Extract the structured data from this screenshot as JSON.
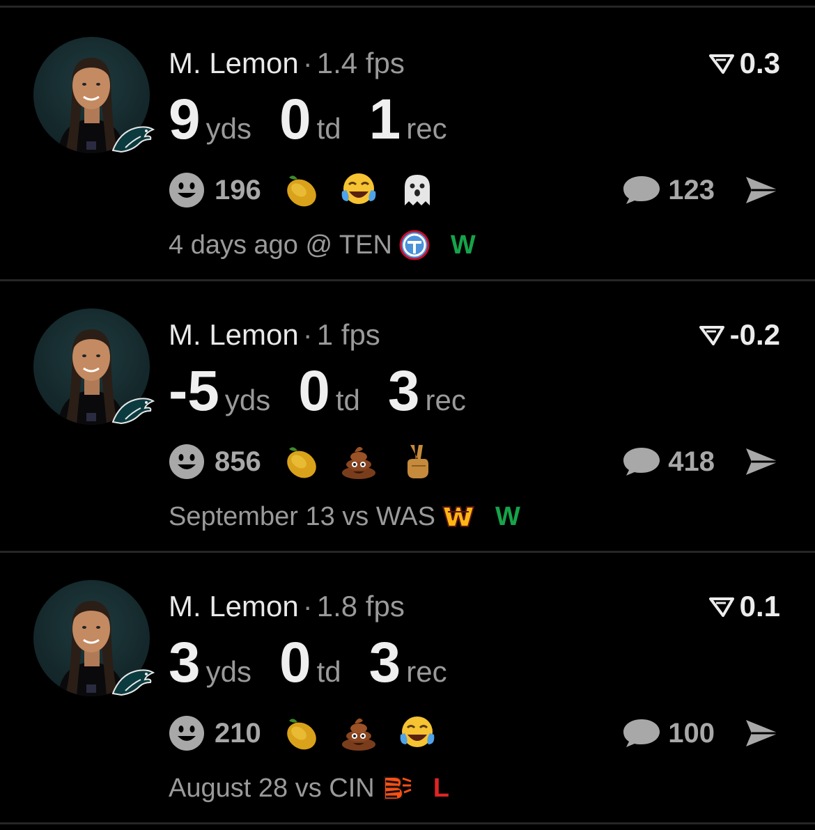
{
  "colors": {
    "win": "#16a34a",
    "loss": "#e02424",
    "background": "#000000"
  },
  "feed": [
    {
      "player": "M. Lemon",
      "fps": "1.4 fps",
      "rating": "0.3",
      "stats": [
        {
          "value": "9",
          "unit": "yds"
        },
        {
          "value": "0",
          "unit": "td"
        },
        {
          "value": "1",
          "unit": "rec"
        }
      ],
      "reaction_count": "196",
      "emojis": [
        "lemon-emoji",
        "tears-of-joy-emoji",
        "ghost-emoji"
      ],
      "comment_count": "123",
      "meta": "4 days ago @ TEN",
      "opponent_logo": "titans-logo",
      "result": "W"
    },
    {
      "player": "M. Lemon",
      "fps": "1 fps",
      "rating": "-0.2",
      "stats": [
        {
          "value": "-5",
          "unit": "yds"
        },
        {
          "value": "0",
          "unit": "td"
        },
        {
          "value": "3",
          "unit": "rec"
        }
      ],
      "reaction_count": "856",
      "emojis": [
        "lemon-emoji",
        "poop-emoji",
        "victory-hand-emoji"
      ],
      "comment_count": "418",
      "meta": "September 13 vs WAS",
      "opponent_logo": "commanders-logo",
      "result": "W"
    },
    {
      "player": "M. Lemon",
      "fps": "1.8 fps",
      "rating": "0.1",
      "stats": [
        {
          "value": "3",
          "unit": "yds"
        },
        {
          "value": "0",
          "unit": "td"
        },
        {
          "value": "3",
          "unit": "rec"
        }
      ],
      "reaction_count": "210",
      "emojis": [
        "lemon-emoji",
        "poop-emoji",
        "tears-of-joy-emoji"
      ],
      "comment_count": "100",
      "meta": "August 28 vs CIN",
      "opponent_logo": "bengals-logo",
      "result": "L"
    }
  ]
}
